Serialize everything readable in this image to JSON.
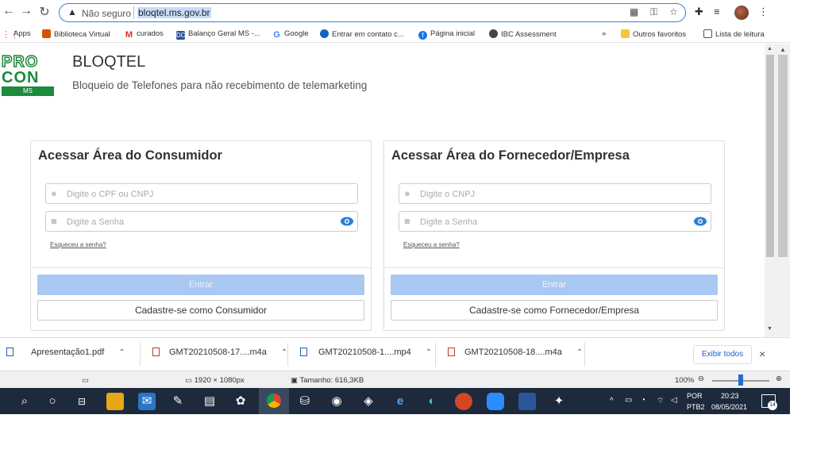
{
  "browser": {
    "security_label": "Não seguro",
    "url": "bloqtel.ms.gov.br"
  },
  "bookmarks": {
    "apps": "Apps",
    "items": [
      "Biblioteca Virtual",
      "curados",
      "Balanço Geral MS -...",
      "Google",
      "Entrar em contato c...",
      "Página inicial",
      "IBC Assessment"
    ],
    "overflow": "»",
    "other": "Outros favoritos",
    "reading_list": "Lista de leitura"
  },
  "logo": {
    "line1": "PRO",
    "line2": "CON",
    "line3": "MS"
  },
  "header": {
    "title": "BLOQTEL",
    "subtitle": "Bloqueio de Telefones para não recebimento de telemarketing"
  },
  "consumer": {
    "title": "Acessar Área do Consumidor",
    "id_placeholder": "Digite o CPF ou CNPJ",
    "password_placeholder": "Digite a Senha",
    "forgot": "Esqueceu a senha?",
    "enter": "Entrar",
    "register": "Cadastre-se como Consumidor"
  },
  "supplier": {
    "title": "Acessar Área do Fornecedor/Empresa",
    "id_placeholder": "Digite o CNPJ",
    "password_placeholder": "Digite a Senha",
    "forgot": "Esqueceu a senha?",
    "enter": "Entrar",
    "register": "Cadastre-se como Fornecedor/Empresa"
  },
  "downloads": {
    "items": [
      "Apresentação1.pdf",
      "GMT20210508-17....m4a",
      "GMT20210508-1....mp4",
      "GMT20210508-18....m4a"
    ],
    "show_all": "Exibir todos",
    "close": "×"
  },
  "statusbar": {
    "resolution": "1920 × 1080px",
    "size": "Tamanho: 616,3KB",
    "zoom": "100%",
    "zoom_fraction": 0.5
  },
  "taskbar": {
    "language": "POR",
    "layout": "PTB2",
    "time": "20:23",
    "date": "08/05/2021",
    "notifications": "14"
  },
  "colors": {
    "brand_green": "#1d8a3d",
    "accent_blue": "#a9c8f2",
    "eye_blue": "#2a7fd4",
    "taskbar": "#1c2a3c"
  }
}
